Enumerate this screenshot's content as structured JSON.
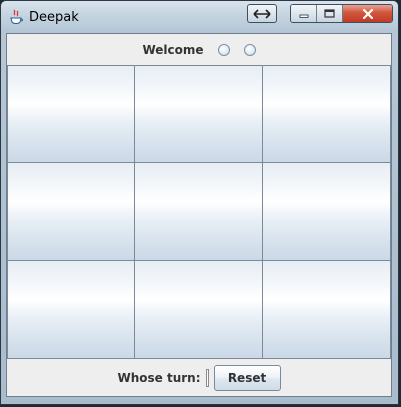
{
  "window": {
    "title": "Deepak",
    "snap_icon": "resize-arrows-icon",
    "caption_icons": [
      "minimize-icon",
      "maximize-icon",
      "close-icon"
    ]
  },
  "header": {
    "welcome_label": "Welcome",
    "radio_count": 2
  },
  "board": {
    "cells": [
      "",
      "",
      "",
      "",
      "",
      "",
      "",
      "",
      ""
    ]
  },
  "footer": {
    "turn_label": "Whose turn:",
    "turn_value": "",
    "reset_label": "Reset"
  },
  "colors": {
    "cell_border": "#7a8a99",
    "panel_bg": "#eeeeee",
    "close_red": "#c23a22"
  }
}
